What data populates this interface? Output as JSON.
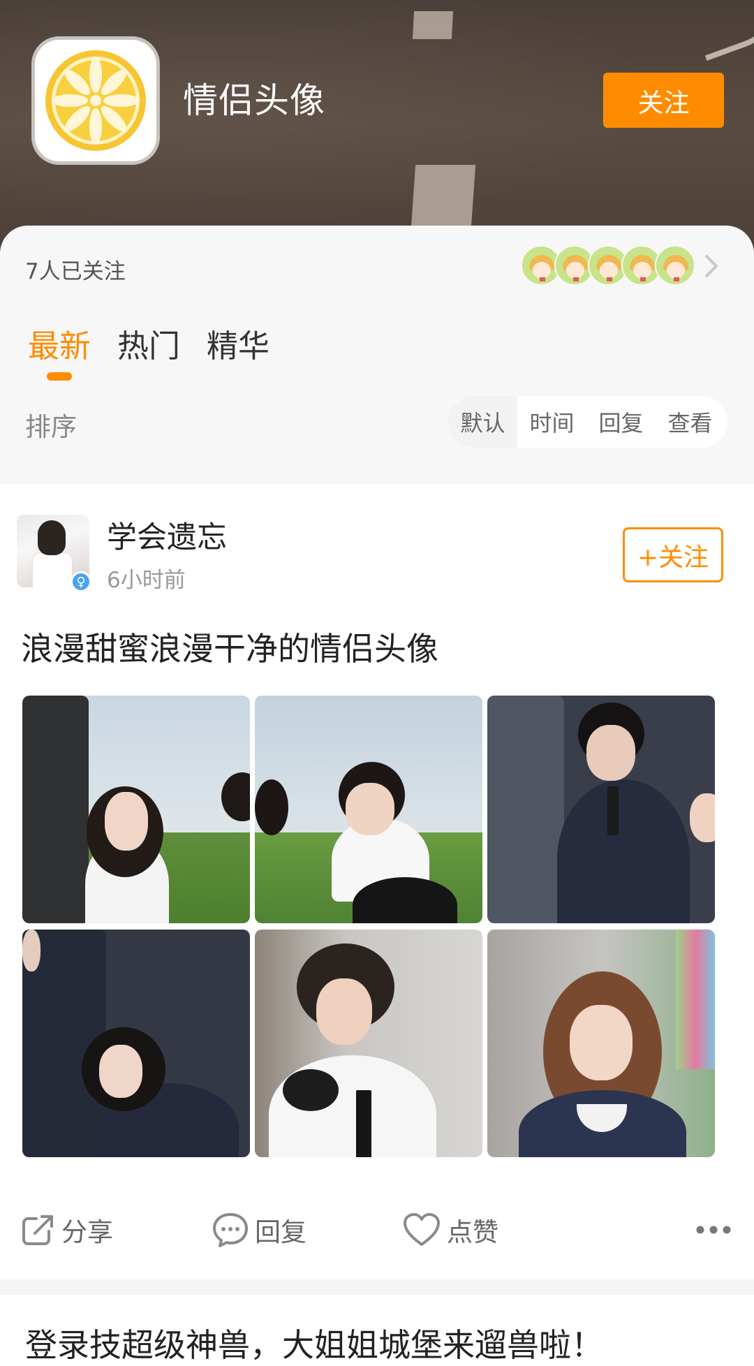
{
  "header": {
    "title": "情侣头像",
    "follow_label": "关注",
    "icon": "lemon-icon"
  },
  "followers": {
    "count_text": "7人已关注",
    "avatar_count": 5
  },
  "tabs": [
    {
      "label": "最新",
      "active": true
    },
    {
      "label": "热门",
      "active": false
    },
    {
      "label": "精华",
      "active": false
    }
  ],
  "sort": {
    "label": "排序",
    "options": [
      "默认",
      "时间",
      "回复",
      "查看"
    ],
    "selected": "默认"
  },
  "post": {
    "author": "学会遗忘",
    "time": "6小时前",
    "gender_symbol": "♀",
    "follow_label": "+关注",
    "title": "浪漫甜蜜浪漫干净的情侣头像",
    "image_count": 6
  },
  "actions": {
    "share": "分享",
    "reply": "回复",
    "like": "点赞"
  },
  "next_post": {
    "title": "登录技超级神兽，大姐姐城堡来遛兽啦！"
  },
  "colors": {
    "accent": "#ff8c00",
    "badge": "#4aa3f0"
  }
}
